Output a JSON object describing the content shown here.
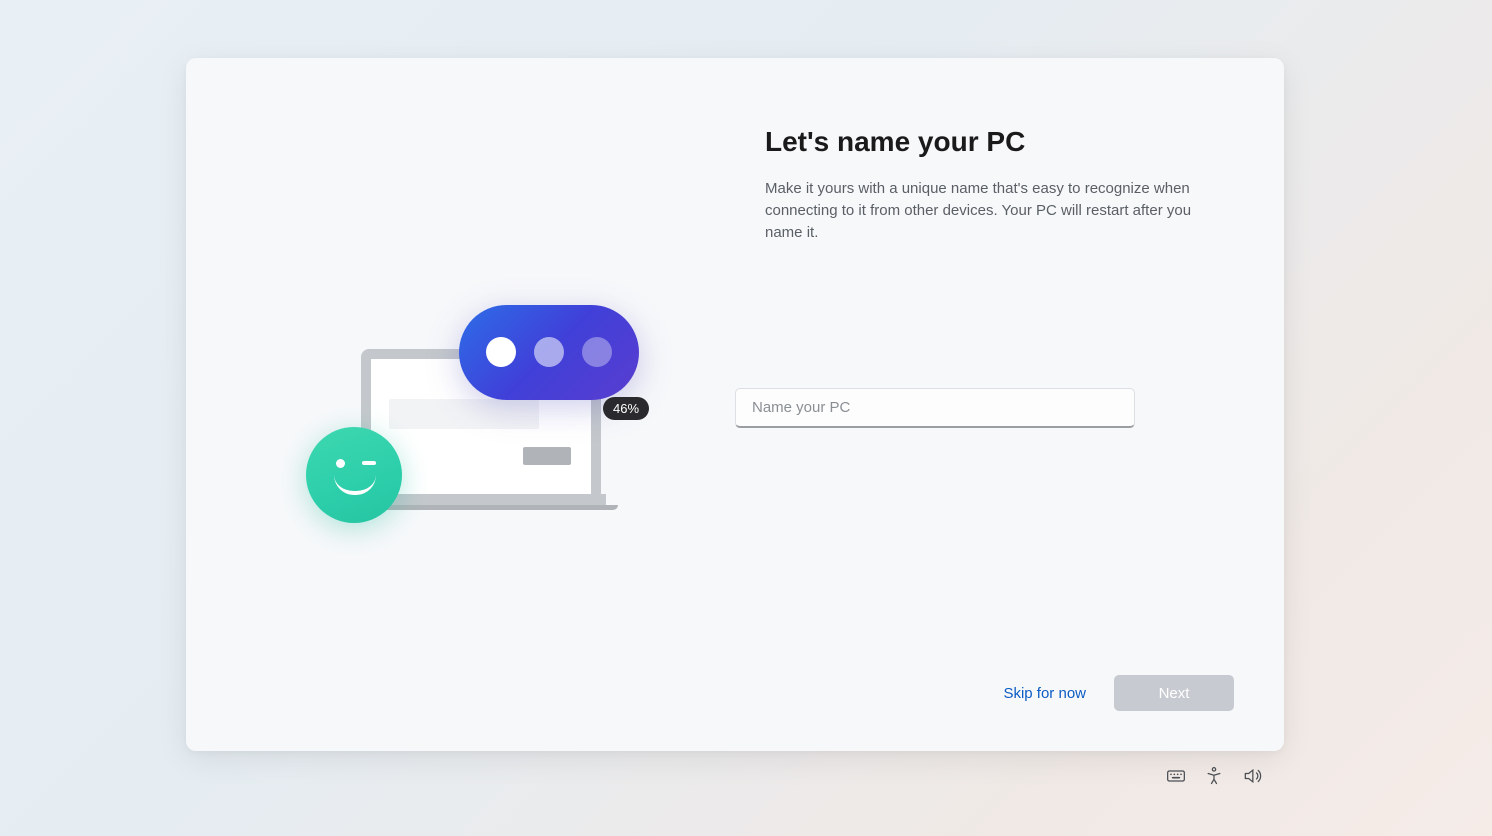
{
  "main": {
    "title": "Let's name your PC",
    "description": "Make it yours with a unique name that's easy to recognize when connecting to it from other devices. Your PC will restart after you name it.",
    "input_placeholder": "Name your PC",
    "input_value": ""
  },
  "progress": {
    "badge_text": "46%"
  },
  "footer": {
    "skip_label": "Skip for now",
    "next_label": "Next"
  },
  "colors": {
    "accent_blue": "#0b5cc4",
    "bubble_gradient_start": "#2d6de8",
    "bubble_gradient_end": "#5a3dd0",
    "smiley_green": "#2cceaa",
    "disabled_button": "#c7cad0"
  }
}
